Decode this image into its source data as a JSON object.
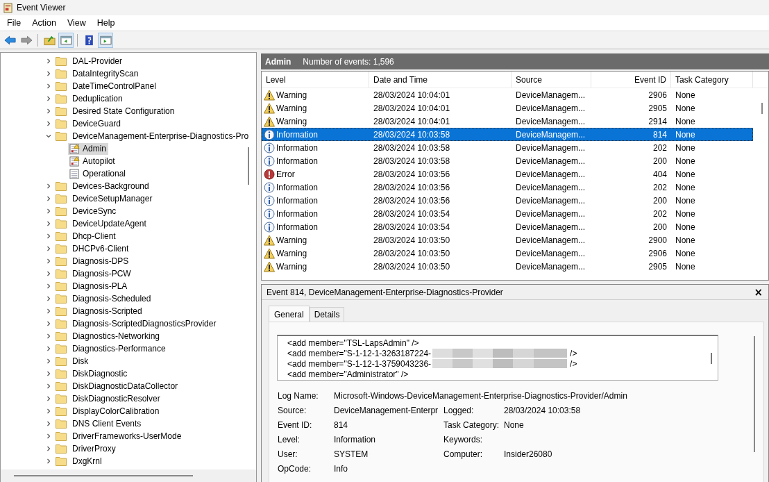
{
  "window": {
    "title": "Event Viewer"
  },
  "menu": [
    "File",
    "Action",
    "View",
    "Help"
  ],
  "toolbar": [
    {
      "kind": "back",
      "pressed": false
    },
    {
      "kind": "forward",
      "pressed": false
    },
    {
      "kind": "up",
      "pressed": false
    },
    {
      "kind": "tree-pane",
      "pressed": true
    },
    {
      "kind": "help",
      "pressed": false
    },
    {
      "kind": "action-pane",
      "pressed": true
    }
  ],
  "tree": [
    {
      "label": "DAL-Provider",
      "expanded": false,
      "selected": false
    },
    {
      "label": "DataIntegrityScan",
      "expanded": false,
      "selected": false
    },
    {
      "label": "DateTimeControlPanel",
      "expanded": false,
      "selected": false
    },
    {
      "label": "Deduplication",
      "expanded": false,
      "selected": false
    },
    {
      "label": "Desired State Configuration",
      "expanded": false,
      "selected": false
    },
    {
      "label": "DeviceGuard",
      "expanded": false,
      "selected": false
    },
    {
      "label": "DeviceManagement-Enterprise-Diagnostics-Pro",
      "expanded": true,
      "selected": false,
      "children": [
        {
          "label": "Admin",
          "kind": "alert-log",
          "selected": true
        },
        {
          "label": "Autopilot",
          "kind": "alert-log",
          "selected": false
        },
        {
          "label": "Operational",
          "kind": "log",
          "selected": false
        }
      ]
    },
    {
      "label": "Devices-Background",
      "expanded": false,
      "selected": false
    },
    {
      "label": "DeviceSetupManager",
      "expanded": false,
      "selected": false
    },
    {
      "label": "DeviceSync",
      "expanded": false,
      "selected": false
    },
    {
      "label": "DeviceUpdateAgent",
      "expanded": false,
      "selected": false
    },
    {
      "label": "Dhcp-Client",
      "expanded": false,
      "selected": false
    },
    {
      "label": "DHCPv6-Client",
      "expanded": false,
      "selected": false
    },
    {
      "label": "Diagnosis-DPS",
      "expanded": false,
      "selected": false
    },
    {
      "label": "Diagnosis-PCW",
      "expanded": false,
      "selected": false
    },
    {
      "label": "Diagnosis-PLA",
      "expanded": false,
      "selected": false
    },
    {
      "label": "Diagnosis-Scheduled",
      "expanded": false,
      "selected": false
    },
    {
      "label": "Diagnosis-Scripted",
      "expanded": false,
      "selected": false
    },
    {
      "label": "Diagnosis-ScriptedDiagnosticsProvider",
      "expanded": false,
      "selected": false
    },
    {
      "label": "Diagnostics-Networking",
      "expanded": false,
      "selected": false
    },
    {
      "label": "Diagnostics-Performance",
      "expanded": false,
      "selected": false
    },
    {
      "label": "Disk",
      "expanded": false,
      "selected": false
    },
    {
      "label": "DiskDiagnostic",
      "expanded": false,
      "selected": false
    },
    {
      "label": "DiskDiagnosticDataCollector",
      "expanded": false,
      "selected": false
    },
    {
      "label": "DiskDiagnosticResolver",
      "expanded": false,
      "selected": false
    },
    {
      "label": "DisplayColorCalibration",
      "expanded": false,
      "selected": false
    },
    {
      "label": "DNS Client Events",
      "expanded": false,
      "selected": false
    },
    {
      "label": "DriverFrameworks-UserMode",
      "expanded": false,
      "selected": false
    },
    {
      "label": "DriverProxy",
      "expanded": false,
      "selected": false
    },
    {
      "label": "DxgKrnl",
      "expanded": false,
      "selected": false
    }
  ],
  "log_header": {
    "title": "Admin",
    "count": "Number of events: 1,596"
  },
  "table": {
    "columns": [
      "Level",
      "Date and Time",
      "Source",
      "Event ID",
      "Task Category"
    ],
    "rows": [
      {
        "kind": "warning",
        "level": "Warning",
        "date": "28/03/2024 10:04:01",
        "source": "DeviceManagem...",
        "event_id": "2906",
        "category": "None",
        "selected": false
      },
      {
        "kind": "warning",
        "level": "Warning",
        "date": "28/03/2024 10:04:01",
        "source": "DeviceManagem...",
        "event_id": "2905",
        "category": "None",
        "selected": false
      },
      {
        "kind": "warning",
        "level": "Warning",
        "date": "28/03/2024 10:04:01",
        "source": "DeviceManagem...",
        "event_id": "2914",
        "category": "None",
        "selected": false
      },
      {
        "kind": "information",
        "level": "Information",
        "date": "28/03/2024 10:03:58",
        "source": "DeviceManagem...",
        "event_id": "814",
        "category": "None",
        "selected": true
      },
      {
        "kind": "information",
        "level": "Information",
        "date": "28/03/2024 10:03:58",
        "source": "DeviceManagem...",
        "event_id": "202",
        "category": "None",
        "selected": false
      },
      {
        "kind": "information",
        "level": "Information",
        "date": "28/03/2024 10:03:58",
        "source": "DeviceManagem...",
        "event_id": "200",
        "category": "None",
        "selected": false
      },
      {
        "kind": "error",
        "level": "Error",
        "date": "28/03/2024 10:03:56",
        "source": "DeviceManagem...",
        "event_id": "404",
        "category": "None",
        "selected": false
      },
      {
        "kind": "information",
        "level": "Information",
        "date": "28/03/2024 10:03:56",
        "source": "DeviceManagem...",
        "event_id": "202",
        "category": "None",
        "selected": false
      },
      {
        "kind": "information",
        "level": "Information",
        "date": "28/03/2024 10:03:56",
        "source": "DeviceManagem...",
        "event_id": "200",
        "category": "None",
        "selected": false
      },
      {
        "kind": "information",
        "level": "Information",
        "date": "28/03/2024 10:03:54",
        "source": "DeviceManagem...",
        "event_id": "202",
        "category": "None",
        "selected": false
      },
      {
        "kind": "information",
        "level": "Information",
        "date": "28/03/2024 10:03:54",
        "source": "DeviceManagem...",
        "event_id": "200",
        "category": "None",
        "selected": false
      },
      {
        "kind": "warning",
        "level": "Warning",
        "date": "28/03/2024 10:03:50",
        "source": "DeviceManagem...",
        "event_id": "2900",
        "category": "None",
        "selected": false
      },
      {
        "kind": "warning",
        "level": "Warning",
        "date": "28/03/2024 10:03:50",
        "source": "DeviceManagem...",
        "event_id": "2906",
        "category": "None",
        "selected": false
      },
      {
        "kind": "warning",
        "level": "Warning",
        "date": "28/03/2024 10:03:50",
        "source": "DeviceManagem...",
        "event_id": "2905",
        "category": "None",
        "selected": false
      }
    ]
  },
  "detail": {
    "title": "Event 814, DeviceManagement-Enterprise-Diagnostics-Provider",
    "close": "×",
    "tabs": [
      {
        "label": "General",
        "selected": true
      },
      {
        "label": "Details",
        "selected": false
      }
    ],
    "xml_lines": [
      {
        "text": "<add member=\"TSL-LapsAdmin\" />",
        "redacted": false
      },
      {
        "text": "<add member=\"S-1-12-1-3263187224-",
        "redacted": true,
        "tail": "/>"
      },
      {
        "text": "<add member=\"S-1-12-1-3759043236-",
        "redacted": true,
        "tail": "/>"
      },
      {
        "text": "<add member=\"Administrator\" />",
        "redacted": false
      }
    ],
    "fields": [
      [
        {
          "label": "Log Name:",
          "value": "Microsoft-Windows-DeviceManagement-Enterprise-Diagnostics-Provider/Admin",
          "wide": true
        }
      ],
      [
        {
          "label": "Source:",
          "value": "DeviceManagement-Enterpr"
        },
        {
          "label": "Logged:",
          "value": "28/03/2024 10:03:58"
        }
      ],
      [
        {
          "label": "Event ID:",
          "value": "814"
        },
        {
          "label": "Task Category:",
          "value": "None"
        }
      ],
      [
        {
          "label": "Level:",
          "value": "Information"
        },
        {
          "label": "Keywords:"
        }
      ],
      [
        {
          "label": "User:",
          "value": "SYSTEM"
        },
        {
          "label": "Computer:",
          "value": "Insider26080"
        }
      ],
      [
        {
          "label": "OpCode:",
          "value": "Info"
        }
      ]
    ]
  }
}
